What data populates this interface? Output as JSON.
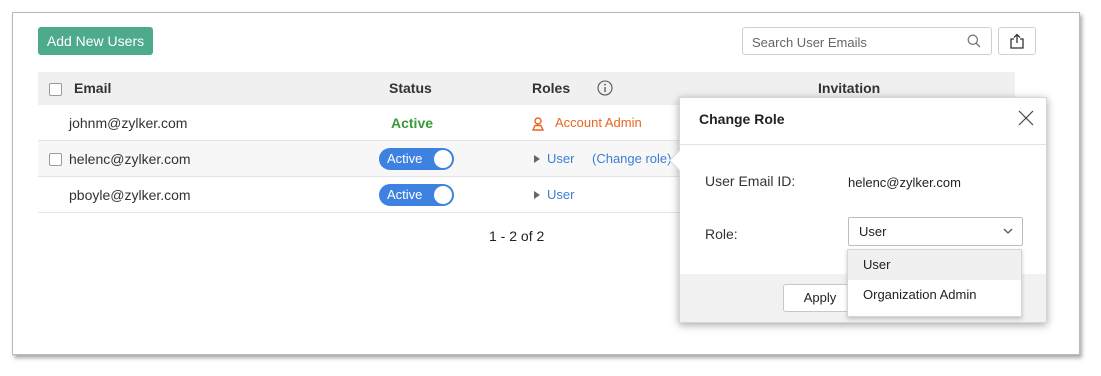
{
  "toolbar": {
    "add_users_label": "Add New Users",
    "search_placeholder": "Search User Emails"
  },
  "table": {
    "columns": [
      "Email",
      "Status",
      "Roles",
      "Invitation"
    ],
    "rows": [
      {
        "email": "johnm@zylker.com",
        "status": "Active",
        "role": "Account Admin"
      },
      {
        "email": "helenc@zylker.com",
        "status": "Active",
        "role": "User",
        "action": "(Change role)"
      },
      {
        "email": "pboyle@zylker.com",
        "status": "Active",
        "role": "User"
      }
    ],
    "pagination": "1 - 2 of 2"
  },
  "popup": {
    "title": "Change Role",
    "email_label": "User Email ID:",
    "email_value": "helenc@zylker.com",
    "role_label": "Role:",
    "role_value": "User",
    "options": [
      "User",
      "Organization Admin"
    ],
    "apply_label": "Apply"
  },
  "colors": {
    "accent_green": "#4daa8c",
    "toggle_blue": "#3d82e0",
    "admin_orange": "#e8661e",
    "active_green": "#3a9a3a"
  }
}
